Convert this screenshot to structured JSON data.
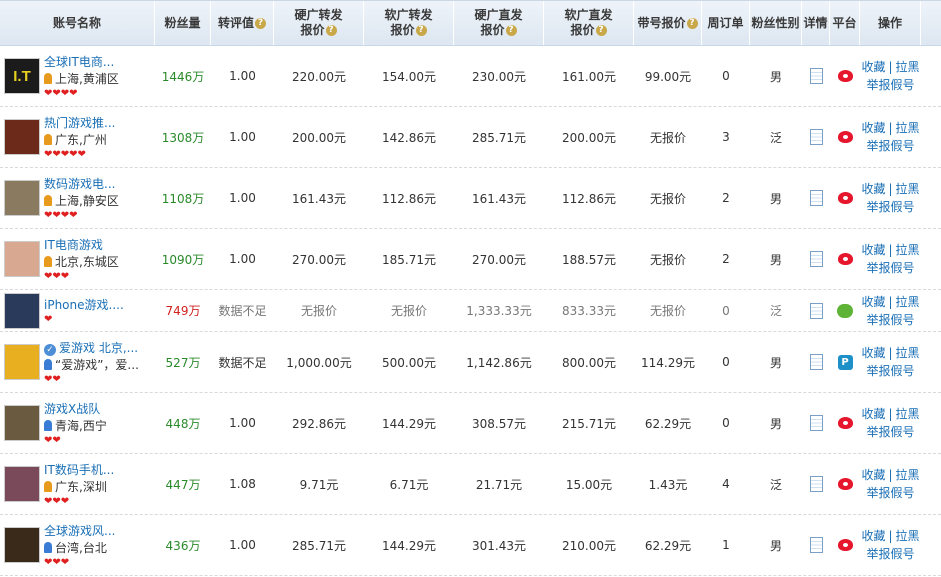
{
  "headers": {
    "account": "账号名称",
    "fans": "粉丝量",
    "repost_eval": "转评值",
    "hard_repost_l1": "硬广转发",
    "hard_repost_l2": "报价",
    "soft_repost_l1": "软广转发",
    "soft_repost_l2": "报价",
    "hard_direct_l1": "硬广直发",
    "hard_direct_l2": "报价",
    "soft_direct_l1": "软广直发",
    "soft_direct_l2": "报价",
    "lead_price": "带号报价",
    "weekly_orders": "周订单",
    "fan_gender": "粉丝性别",
    "detail": "详情",
    "platform": "平台",
    "operation": "操作",
    "help_glyph": "?"
  },
  "actions": {
    "favorite": "收藏",
    "sep": "|",
    "blacklist": "拉黑",
    "report": "举报假号"
  },
  "rows": [
    {
      "name": "全球IT电商...",
      "location": "上海,黄浦区",
      "gender_icon": "female",
      "hearts": "❤❤❤❤",
      "fans": "1446万",
      "eval": "1.00",
      "hard_repost": "220.00元",
      "soft_repost": "154.00元",
      "hard_direct": "230.00元",
      "soft_direct": "161.00元",
      "lead_price": "99.00元",
      "weekly": "0",
      "fan_gender": "男",
      "platform": "weibo-icon",
      "avatar_color": "#1b1b1b",
      "avatar_text": "I.T"
    },
    {
      "name": "热门游戏推...",
      "location": "广东,广州",
      "gender_icon": "female",
      "hearts": "❤❤❤❤❤",
      "fans": "1308万",
      "eval": "1.00",
      "hard_repost": "200.00元",
      "soft_repost": "142.86元",
      "hard_direct": "285.71元",
      "soft_direct": "200.00元",
      "lead_price": "无报价",
      "weekly": "3",
      "fan_gender": "泛",
      "platform": "weibo-icon",
      "avatar_color": "#6b2a1a",
      "avatar_text": ""
    },
    {
      "name": "数码游戏电...",
      "location": "上海,静安区",
      "gender_icon": "female",
      "hearts": "❤❤❤❤",
      "fans": "1108万",
      "eval": "1.00",
      "hard_repost": "161.43元",
      "soft_repost": "112.86元",
      "hard_direct": "161.43元",
      "soft_direct": "112.86元",
      "lead_price": "无报价",
      "weekly": "2",
      "fan_gender": "男",
      "platform": "weibo-icon",
      "avatar_color": "#8a7a60",
      "avatar_text": ""
    },
    {
      "name": "IT电商游戏",
      "location": "北京,东城区",
      "gender_icon": "female",
      "hearts": "❤❤❤",
      "fans": "1090万",
      "eval": "1.00",
      "hard_repost": "270.00元",
      "soft_repost": "185.71元",
      "hard_direct": "270.00元",
      "soft_direct": "188.57元",
      "lead_price": "无报价",
      "weekly": "2",
      "fan_gender": "男",
      "platform": "weibo-icon",
      "avatar_color": "#d9a890",
      "avatar_text": ""
    },
    {
      "name": "iPhone游戏....",
      "location": "",
      "gender_icon": "",
      "hearts": "❤",
      "fans": "749万",
      "fans_red": true,
      "eval": "数据不足",
      "hard_repost": "无报价",
      "soft_repost": "无报价",
      "hard_direct": "1,333.33元",
      "soft_direct": "833.33元",
      "lead_price": "无报价",
      "weekly": "0",
      "fan_gender": "泛",
      "platform": "wechat-icon",
      "grey": true,
      "avatar_color": "#2a3a5a",
      "avatar_text": ""
    },
    {
      "name": "爱游戏  北京,...",
      "location": "“爱游戏”，爱...",
      "gender_icon": "male",
      "hearts": "❤❤",
      "fans": "527万",
      "eval": "数据不足",
      "hard_repost": "1,000.00元",
      "soft_repost": "500.00元",
      "hard_direct": "1,142.86元",
      "soft_direct": "800.00元",
      "lead_price": "114.29元",
      "weekly": "0",
      "fan_gender": "男",
      "platform": "tencent-icon",
      "verified": true,
      "avatar_color": "#e8b020",
      "avatar_text": ""
    },
    {
      "name": "游戏X战队",
      "location": "青海,西宁",
      "gender_icon": "male",
      "hearts": "❤❤",
      "fans": "448万",
      "eval": "1.00",
      "hard_repost": "292.86元",
      "soft_repost": "144.29元",
      "hard_direct": "308.57元",
      "soft_direct": "215.71元",
      "lead_price": "62.29元",
      "weekly": "0",
      "fan_gender": "男",
      "platform": "weibo-icon",
      "avatar_color": "#6a5a40",
      "avatar_text": ""
    },
    {
      "name": "IT数码手机...",
      "location": "广东,深圳",
      "gender_icon": "female",
      "hearts": "❤❤❤",
      "fans": "447万",
      "eval": "1.08",
      "hard_repost": "9.71元",
      "soft_repost": "6.71元",
      "hard_direct": "21.71元",
      "soft_direct": "15.00元",
      "lead_price": "1.43元",
      "weekly": "4",
      "fan_gender": "泛",
      "platform": "weibo-icon",
      "avatar_color": "#7a4a5a",
      "avatar_text": ""
    },
    {
      "name": "全球游戏风...",
      "location": "台湾,台北",
      "gender_icon": "male",
      "hearts": "❤❤❤",
      "fans": "436万",
      "eval": "1.00",
      "hard_repost": "285.71元",
      "soft_repost": "144.29元",
      "hard_direct": "301.43元",
      "soft_direct": "210.00元",
      "lead_price": "62.29元",
      "weekly": "1",
      "fan_gender": "男",
      "platform": "weibo-icon",
      "avatar_color": "#3a2a1a",
      "avatar_text": ""
    }
  ]
}
